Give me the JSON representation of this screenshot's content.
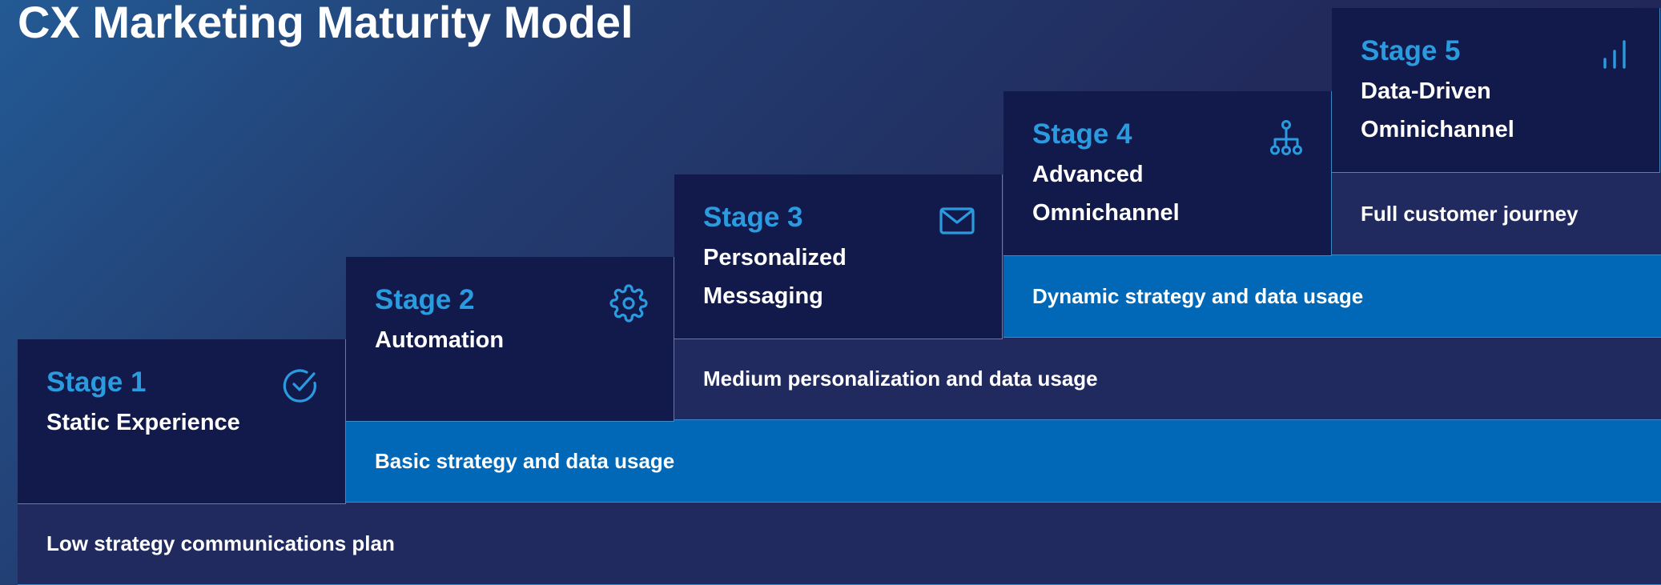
{
  "title": "CX Marketing Maturity Model",
  "accent_color": "#2b9be0",
  "stage_box_color": "#121a4c",
  "bar_colors": {
    "navy": "#202a5e",
    "blue": "#0068b6"
  },
  "stages": [
    {
      "label": "Stage 1",
      "name": "Static Experience",
      "icon": "check-circle-icon"
    },
    {
      "label": "Stage 2",
      "name": "Automation",
      "icon": "gear-icon"
    },
    {
      "label": "Stage 3",
      "name": "Personalized Messaging",
      "icon": "envelope-icon"
    },
    {
      "label": "Stage 4",
      "name": "Advanced Omnichannel",
      "icon": "hierarchy-icon"
    },
    {
      "label": "Stage 5",
      "name": "Data-Driven Ominichannel",
      "icon": "signal-bars-icon"
    }
  ],
  "bars": [
    {
      "text": "Low strategy communications plan",
      "style": "navy"
    },
    {
      "text": "Basic strategy and data usage",
      "style": "blue"
    },
    {
      "text": "Medium personalization and data usage",
      "style": "navy"
    },
    {
      "text": "Dynamic strategy and data usage",
      "style": "blue"
    },
    {
      "text": "Full customer journey",
      "style": "navy"
    }
  ]
}
